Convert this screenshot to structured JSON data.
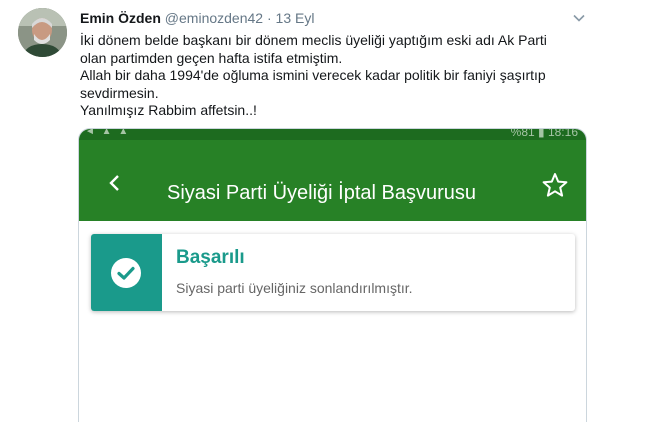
{
  "tweet": {
    "display_name": "Emin Özden",
    "handle": "@eminozden42",
    "separator": "·",
    "date": "13 Eyl",
    "lines": [
      "İki dönem belde başkanı bir dönem meclis üyeliği yaptığım eski adı Ak Parti",
      "olan partimden geçen hafta istifa etmiştim.",
      "Allah bir daha 1994'de oğluma ismini verecek kadar politik bir faniyi şaşırtıp",
      "sevdirmesin.",
      "Yanılmışız Rabbim affetsin..!"
    ]
  },
  "embed": {
    "status_left": "◄ ▲ ▲",
    "status_right": "%81 ▮ 18:16",
    "app_title": "Siyasi Parti Üyeliği İptal Başvurusu",
    "card": {
      "title": "Başarılı",
      "message": "Siyasi parti üyeliğiniz sonlandırılmıştır."
    },
    "colors": {
      "appbar": "#278126",
      "statusbar": "#1d6b1f",
      "success": "#1a9a8b"
    }
  }
}
